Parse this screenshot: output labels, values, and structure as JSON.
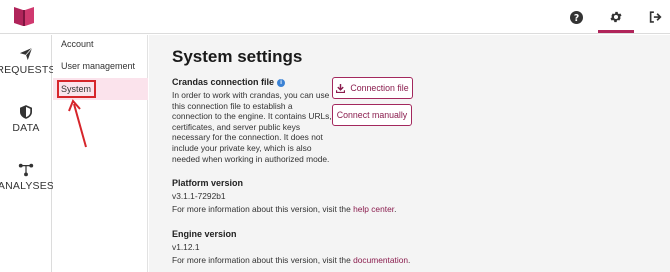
{
  "colors": {
    "accent": "#b0245a",
    "link": "#8a1d4e",
    "highlight_box": "#d6252b",
    "selected_bg": "#fbe3ec",
    "info": "#3b82d4"
  },
  "topbar": {
    "icons": [
      "book-logo-icon",
      "help-icon",
      "gear-icon",
      "logout-icon"
    ]
  },
  "leftnav": {
    "items": [
      {
        "label": "REQUESTS",
        "icon": "paper-plane-icon"
      },
      {
        "label": "DATA",
        "icon": "shield-icon"
      },
      {
        "label": "ANALYSES",
        "icon": "network-icon"
      }
    ]
  },
  "subnav": {
    "items": [
      {
        "label": "Account"
      },
      {
        "label": "User management"
      },
      {
        "label": "System",
        "selected": true
      }
    ]
  },
  "main": {
    "title": "System settings",
    "connection_file": {
      "heading": "Crandas connection file",
      "description": "In order to work with crandas, you can use this connection file to establish a connection to the engine. It contains URLs, certificates, and server public keys necessary for the connection. It does not include your private key, which is also needed when working in authorized mode.",
      "download_button": "Connection file",
      "manual_button": "Connect manually"
    },
    "platform_version": {
      "heading": "Platform version",
      "value": "v3.1.1-7292b1",
      "info_prefix": "For more information about this version, visit the ",
      "info_link": "help center",
      "info_suffix": "."
    },
    "engine_version": {
      "heading": "Engine version",
      "value": "v1.12.1",
      "info_prefix": "For more information about this version, visit the ",
      "info_link": "documentation",
      "info_suffix": "."
    }
  }
}
